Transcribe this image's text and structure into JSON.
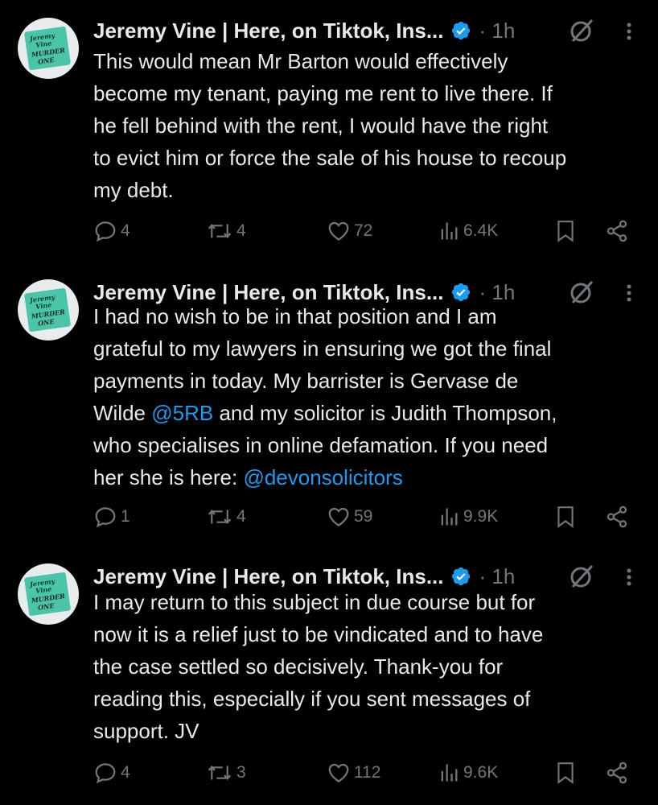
{
  "tweets": [
    {
      "author": "Jeremy Vine | Here, on Tiktok, Ins...",
      "time": "1h",
      "lines": [
        [
          {
            "t": "This would mean Mr Barton would effectively"
          }
        ],
        [
          {
            "t": "become my tenant, paying me rent to live there. If"
          }
        ],
        [
          {
            "t": "he fell behind with the rent, I would have the right"
          }
        ],
        [
          {
            "t": "to evict him or force the sale of his house to recoup"
          }
        ],
        [
          {
            "t": "my debt."
          }
        ]
      ],
      "replies": "4",
      "reposts": "4",
      "likes": "72",
      "views": "6.4K"
    },
    {
      "author": "Jeremy Vine | Here, on Tiktok, Ins...",
      "time": "1h",
      "lines": [
        [
          {
            "t": "I had no wish to be in that position and I am"
          }
        ],
        [
          {
            "t": "grateful to my lawyers in ensuring we got the final"
          }
        ],
        [
          {
            "t": "payments in today. My barrister is Gervase de"
          }
        ],
        [
          {
            "t": "Wilde "
          },
          {
            "t": "@5RB",
            "link": true
          },
          {
            "t": " and my solicitor is Judith Thompson,"
          }
        ],
        [
          {
            "t": "who specialises in online defamation. If you need"
          }
        ],
        [
          {
            "t": "her she is here: "
          },
          {
            "t": "@devonsolicitors",
            "link": true
          }
        ]
      ],
      "replies": "1",
      "reposts": "4",
      "likes": "59",
      "views": "9.9K"
    },
    {
      "author": "Jeremy Vine | Here, on Tiktok, Ins...",
      "time": "1h",
      "lines": [
        [
          {
            "t": "I may return to this subject in due course but for"
          }
        ],
        [
          {
            "t": "now it is a relief just to be vindicated and to have"
          }
        ],
        [
          {
            "t": "the case settled so decisively. Thank-you for"
          }
        ],
        [
          {
            "t": "reading this, especially if you sent messages of"
          }
        ],
        [
          {
            "t": "support. JV"
          }
        ]
      ],
      "replies": "4",
      "reposts": "3",
      "likes": "112",
      "views": "9.6K"
    }
  ],
  "colors": {
    "background": "#000000",
    "text": "#e7e9ea",
    "muted": "#71767b",
    "link": "#1d9bf0",
    "verified": "#1d9bf0",
    "avatar_book": "#4bc4a7"
  },
  "icons": [
    "avatar",
    "verified-badge-icon",
    "grok-icon",
    "more-options-icon",
    "reply-icon",
    "repost-icon",
    "like-icon",
    "views-icon",
    "bookmark-icon",
    "share-icon"
  ]
}
